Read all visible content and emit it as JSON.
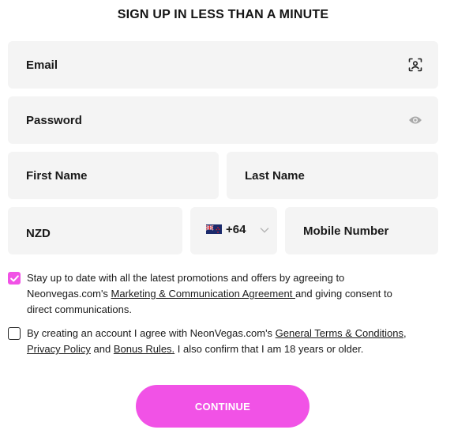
{
  "form": {
    "title": "SIGN UP IN LESS THAN A MINUTE",
    "email": {
      "label": "Email",
      "icon": "face-scan-icon"
    },
    "password": {
      "label": "Password",
      "icon": "eye-icon"
    },
    "first_name": {
      "label": "First Name"
    },
    "last_name": {
      "label": "Last Name"
    },
    "currency": {
      "label": "NZD"
    },
    "country_code": {
      "flag": "new-zealand-flag-icon",
      "code": "+64",
      "icon": "chevron-down-icon"
    },
    "mobile": {
      "label": "Mobile Number"
    },
    "promo": {
      "checked": true,
      "text_before": "Stay up to date with all the latest promotions and offers by agreeing to Neonvegas.com's ",
      "link": "Marketing & Communication Agreement ",
      "text_after": "and giving consent to direct communications."
    },
    "terms": {
      "checked": false,
      "text_1": "By creating an account I agree with NeonVegas.com's ",
      "link_terms": "General Terms & Conditions",
      "text_2": ", ",
      "link_privacy": "Privacy Policy",
      "text_3": " and ",
      "link_bonus": "Bonus Rules.",
      "text_4": " I also confirm that I am 18 years or older."
    },
    "continue_label": "CONTINUE"
  },
  "colors": {
    "accent": "#f152e6",
    "field_bg": "#f4f4f4",
    "text": "#1a1a1a"
  }
}
